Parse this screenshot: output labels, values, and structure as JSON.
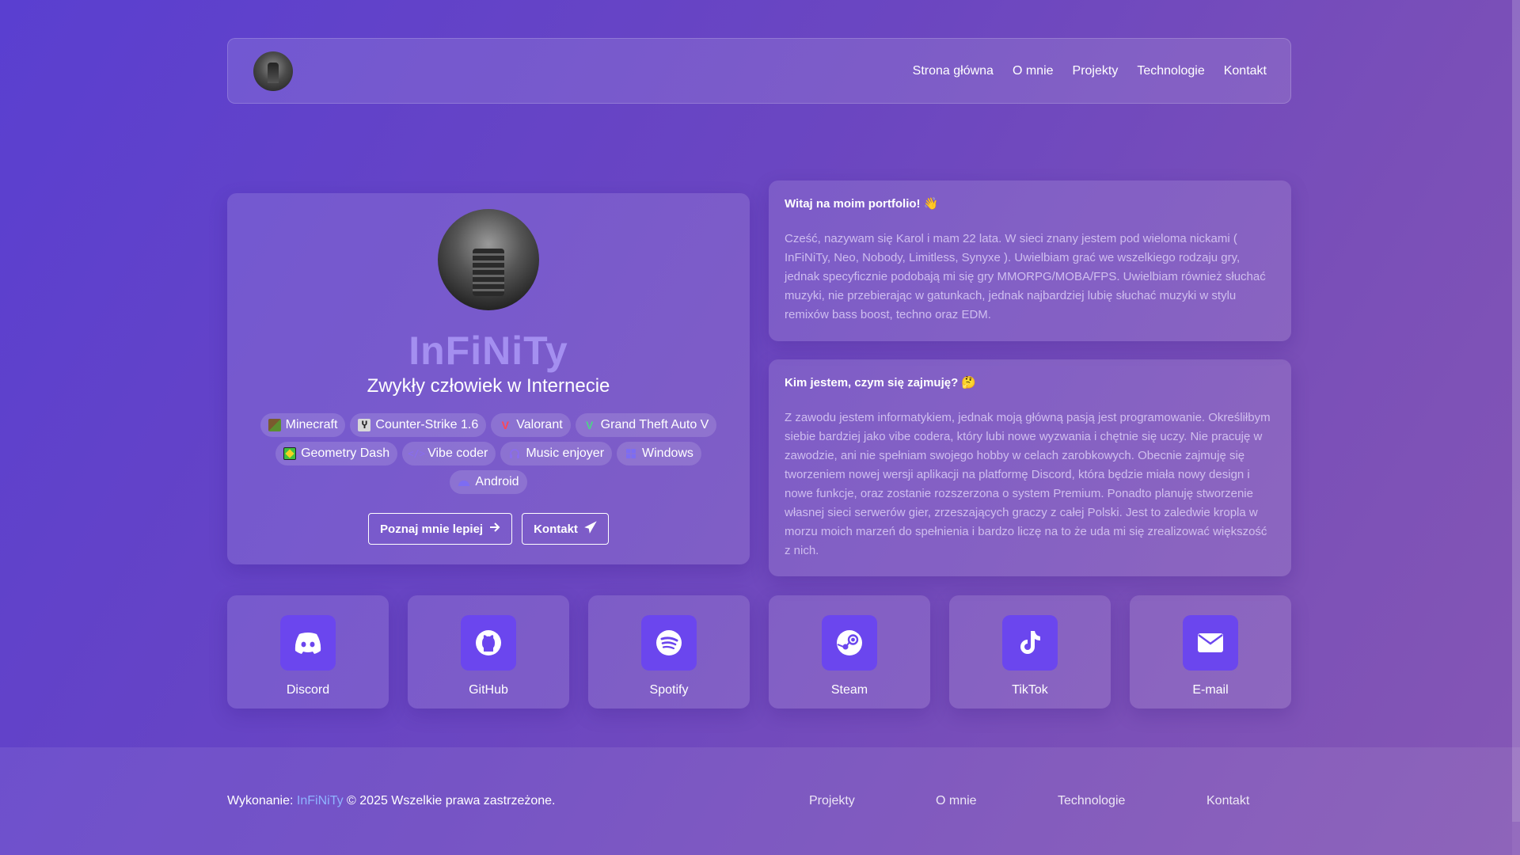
{
  "navbar": {
    "links": [
      "Strona główna",
      "O mnie",
      "Projekty",
      "Technologie",
      "Kontakt"
    ]
  },
  "profile": {
    "name": "InFiNiTy",
    "tagline": "Zwykły człowiek w Internecie",
    "tags": [
      {
        "label": "Minecraft",
        "icon": "minecraft-icon"
      },
      {
        "label": "Counter-Strike 1.6",
        "icon": "counter-strike-icon"
      },
      {
        "label": "Valorant",
        "icon": "valorant-icon"
      },
      {
        "label": "Grand Theft Auto V",
        "icon": "gta-icon"
      },
      {
        "label": "Geometry Dash",
        "icon": "geometry-dash-icon"
      },
      {
        "label": "Vibe coder",
        "icon": "code-icon"
      },
      {
        "label": "Music enjoyer",
        "icon": "headphones-icon"
      },
      {
        "label": "Windows",
        "icon": "windows-icon"
      },
      {
        "label": "Android",
        "icon": "android-icon"
      }
    ],
    "buttons": {
      "about": "Poznaj mnie lepiej",
      "contact": "Kontakt"
    }
  },
  "welcome": {
    "title": "Witaj na moim portfolio! 👋",
    "text": "Cześć, nazywam się Karol i mam 22 lata. W sieci znany jestem pod wieloma nickami ( InFiNiTy, Neo, Nobody, Limitless, Synyxe ). Uwielbiam grać we wszelkiego rodzaju gry, jednak specyficznie podobają mi się gry MMORPG/MOBA/FPS. Uwielbiam również słuchać muzyki, nie przebierając w gatunkach, jednak najbardziej lubię słuchać muzyki w stylu remixów bass boost, techno oraz EDM."
  },
  "about": {
    "title": "Kim jestem, czym się zajmuję? 🤔",
    "text": "Z zawodu jestem informatykiem, jednak moją główną pasją jest programowanie. Określiłbym siebie bardziej jako vibe codera, który lubi nowe wyzwania i chętnie się uczy. Nie pracuję w zawodzie, ani nie spełniam swojego hobby w celach zarobkowych. Obecnie zajmuję się tworzeniem nowej wersji aplikacji na platformę Discord, która będzie miała nowy design i nowe funkcje, oraz zostanie rozszerzona o system Premium. Ponadto planuję stworzenie własnej sieci serwerów gier, zrzeszających graczy z całej Polski. Jest to zaledwie kropla w morzu moich marzeń do spełnienia i bardzo liczę na to że uda mi się zrealizować większość z nich."
  },
  "socials": [
    {
      "label": "Discord",
      "icon": "discord-icon"
    },
    {
      "label": "GitHub",
      "icon": "github-icon"
    },
    {
      "label": "Spotify",
      "icon": "spotify-icon"
    },
    {
      "label": "Steam",
      "icon": "steam-icon"
    },
    {
      "label": "TikTok",
      "icon": "tiktok-icon"
    },
    {
      "label": "E-mail",
      "icon": "email-icon"
    }
  ],
  "footer": {
    "credit_prefix": "Wykonanie:",
    "credit_brand": "InFiNiTy",
    "credit_suffix": "© 2025 Wszelkie prawa zastrzeżone.",
    "links": [
      "Projekty",
      "O mnie",
      "Technologie",
      "Kontakt"
    ]
  },
  "colors": {
    "accent": "#6b46ee",
    "name_color": "#a48ff0",
    "brand_link": "#8fb4ff"
  }
}
